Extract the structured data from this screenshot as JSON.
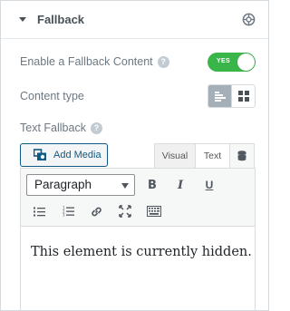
{
  "section": {
    "title": "Fallback",
    "caret_icon": "caret-down-icon",
    "dynamic_icon": "dynamic-tags-icon"
  },
  "fallback_toggle": {
    "label": "Enable a Fallback Content",
    "state_label": "YES",
    "enabled": true,
    "color": "#39b54a"
  },
  "content_type": {
    "label": "Content type",
    "options": [
      {
        "icon": "text-align-left-icon",
        "active": true
      },
      {
        "icon": "grid-template-icon",
        "active": false
      }
    ]
  },
  "text_fallback": {
    "label": "Text Fallback",
    "add_media_label": "Add Media",
    "tabs": {
      "visual": "Visual",
      "text": "Text"
    },
    "format_selected": "Paragraph",
    "toolbar_icons": [
      "bold-icon",
      "italic-icon",
      "underline-icon",
      "bullet-list-icon",
      "numbered-list-icon",
      "link-icon",
      "fullscreen-icon",
      "toolbar-toggle-icon"
    ],
    "bold_glyph": "B",
    "italic_glyph": "I",
    "underline_glyph": "U",
    "content": "This element is currently hidden."
  },
  "colors": {
    "accent": "#0e5a84",
    "label": "#6d7882",
    "toggle": "#39b54a"
  }
}
